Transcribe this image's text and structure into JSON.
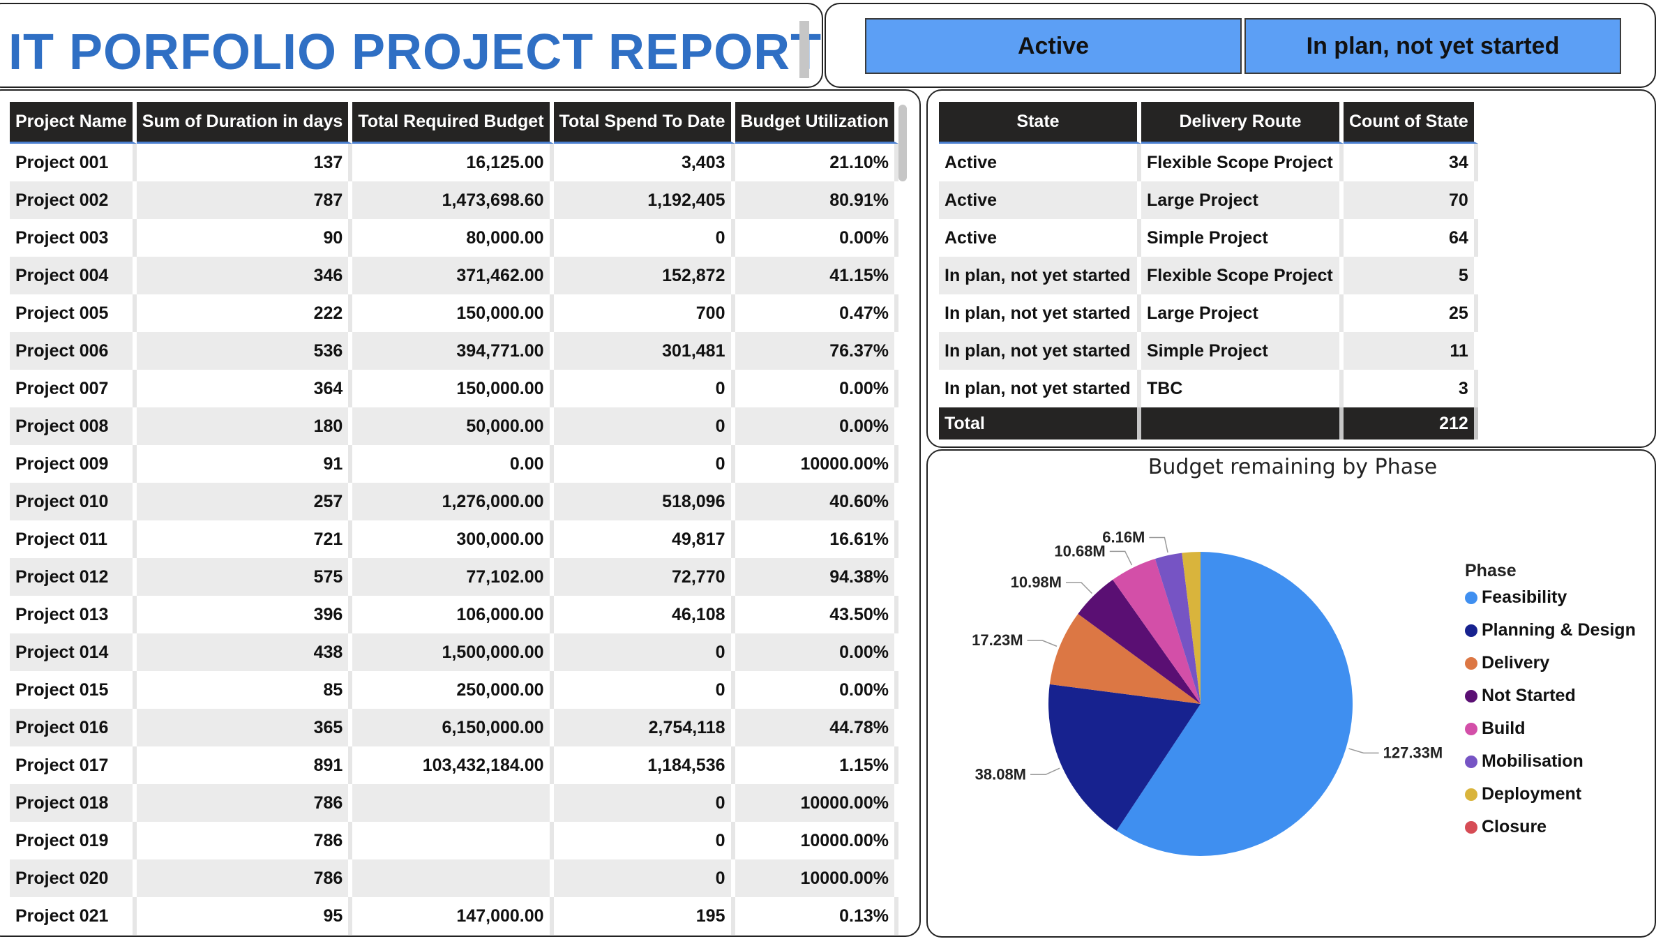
{
  "report": {
    "title": "IT PORFOLIO PROJECT REPORT"
  },
  "slicer": {
    "options": [
      "Active",
      "In plan, not yet started"
    ]
  },
  "project_table": {
    "headers": [
      "Project Name",
      "Sum of Duration in days",
      "Total Required Budget",
      "Total Spend To Date",
      "Budget Utilization"
    ],
    "rows": [
      [
        "Project 001",
        "137",
        "16,125.00",
        "3,403",
        "21.10%"
      ],
      [
        "Project 002",
        "787",
        "1,473,698.60",
        "1,192,405",
        "80.91%"
      ],
      [
        "Project 003",
        "90",
        "80,000.00",
        "0",
        "0.00%"
      ],
      [
        "Project 004",
        "346",
        "371,462.00",
        "152,872",
        "41.15%"
      ],
      [
        "Project 005",
        "222",
        "150,000.00",
        "700",
        "0.47%"
      ],
      [
        "Project 006",
        "536",
        "394,771.00",
        "301,481",
        "76.37%"
      ],
      [
        "Project 007",
        "364",
        "150,000.00",
        "0",
        "0.00%"
      ],
      [
        "Project 008",
        "180",
        "50,000.00",
        "0",
        "0.00%"
      ],
      [
        "Project 009",
        "91",
        "0.00",
        "0",
        "10000.00%"
      ],
      [
        "Project 010",
        "257",
        "1,276,000.00",
        "518,096",
        "40.60%"
      ],
      [
        "Project 011",
        "721",
        "300,000.00",
        "49,817",
        "16.61%"
      ],
      [
        "Project 012",
        "575",
        "77,102.00",
        "72,770",
        "94.38%"
      ],
      [
        "Project 013",
        "396",
        "106,000.00",
        "46,108",
        "43.50%"
      ],
      [
        "Project 014",
        "438",
        "1,500,000.00",
        "0",
        "0.00%"
      ],
      [
        "Project 015",
        "85",
        "250,000.00",
        "0",
        "0.00%"
      ],
      [
        "Project 016",
        "365",
        "6,150,000.00",
        "2,754,118",
        "44.78%"
      ],
      [
        "Project 017",
        "891",
        "103,432,184.00",
        "1,184,536",
        "1.15%"
      ],
      [
        "Project 018",
        "786",
        "",
        "0",
        "10000.00%"
      ],
      [
        "Project 019",
        "786",
        "",
        "0",
        "10000.00%"
      ],
      [
        "Project 020",
        "786",
        "",
        "0",
        "10000.00%"
      ],
      [
        "Project 021",
        "95",
        "147,000.00",
        "195",
        "0.13%"
      ]
    ]
  },
  "state_table": {
    "headers": [
      "State",
      "Delivery Route",
      "Count of State"
    ],
    "rows": [
      [
        "Active",
        "Flexible Scope Project",
        "34"
      ],
      [
        "Active",
        "Large Project",
        "70"
      ],
      [
        "Active",
        "Simple Project",
        "64"
      ],
      [
        "In plan, not yet started",
        "Flexible Scope Project",
        "5"
      ],
      [
        "In plan, not yet started",
        "Large Project",
        "25"
      ],
      [
        "In plan, not yet started",
        "Simple Project",
        "11"
      ],
      [
        "In plan, not yet started",
        "TBC",
        "3"
      ]
    ],
    "total": [
      "Total",
      "",
      "212"
    ]
  },
  "chart_data": {
    "type": "pie",
    "title": "Budget remaining by Phase",
    "legend_title": "Phase",
    "legend_position": "right",
    "slices": [
      {
        "label": "Feasibility",
        "value": 127.33,
        "display": "127.33M",
        "color": "#3f8ff0"
      },
      {
        "label": "Planning & Design",
        "value": 38.08,
        "display": "38.08M",
        "color": "#17228f"
      },
      {
        "label": "Delivery",
        "value": 17.23,
        "display": "17.23M",
        "color": "#dc7744"
      },
      {
        "label": "Not Started",
        "value": 10.98,
        "display": "10.98M",
        "color": "#5a0f73"
      },
      {
        "label": "Build",
        "value": 10.68,
        "display": "10.68M",
        "color": "#d34fa8"
      },
      {
        "label": "Mobilisation",
        "value": 6.16,
        "display": "6.16M",
        "color": "#7654c4"
      },
      {
        "label": "Deployment",
        "value": 4.2,
        "display": "",
        "color": "#d9b43c"
      },
      {
        "label": "Closure",
        "value": 0,
        "display": "",
        "color": "#d64c55"
      }
    ]
  }
}
